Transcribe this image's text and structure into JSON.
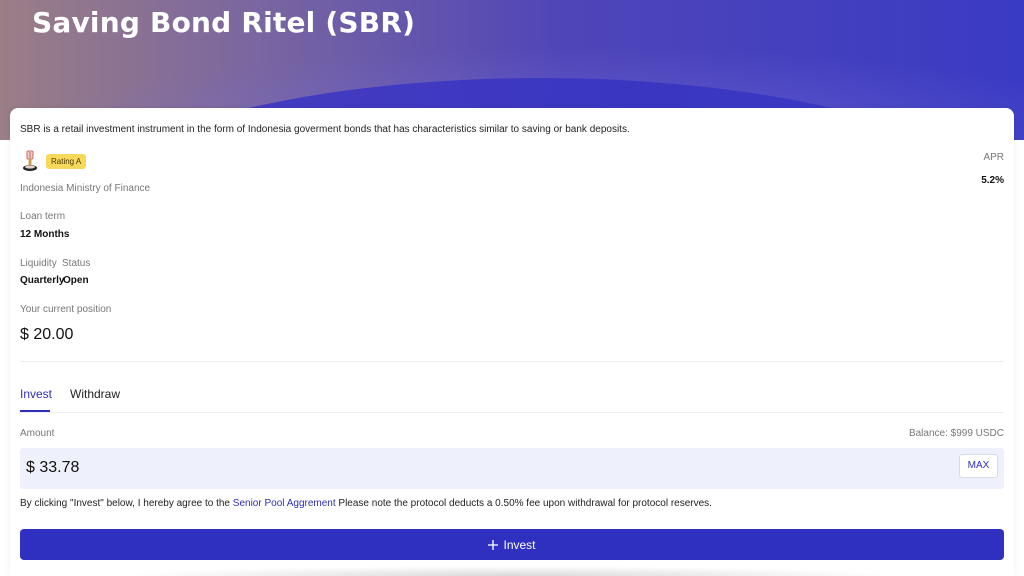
{
  "header": {
    "title": "Saving Bond Ritel (SBR)"
  },
  "product": {
    "description": "SBR is a retail investment instrument in the form of Indonesia goverment bonds that has characteristics similar to saving or bank deposits.",
    "rating": "Rating A",
    "issuer": "Indonesia Ministry of Finance",
    "apr_label": "APR",
    "apr_value": "5.2%",
    "loan_term_label": "Loan term",
    "loan_term_value": "12 Months",
    "liquidity_label": "Liquidity",
    "status_label": "Status",
    "liquidity_value": "Quarterly",
    "status_value": "Open",
    "position_label": "Your current position",
    "position_value": "$ 20.00"
  },
  "tabs": [
    {
      "label": "Invest",
      "active": true
    },
    {
      "label": "Withdraw",
      "active": false
    }
  ],
  "form": {
    "amount_label": "Amount",
    "balance": "Balance: $999 USDC",
    "amount_value": "$ 33.78",
    "max_label": "MAX",
    "agree_prefix": "By clicking \"Invest\" below, I hereby agree to the",
    "agree_link": "Senior Pool Aggrement",
    "agree_suffix": "Please note the protocol deducts a 0.50% fee upon withdrawal for protocol reserves.",
    "submit_label": "Invest",
    "submit_icon": "plus-icon"
  },
  "colors": {
    "accent": "#2f2fc0",
    "rating_badge": "#f7d85a",
    "input_bg": "#eef1fb"
  }
}
